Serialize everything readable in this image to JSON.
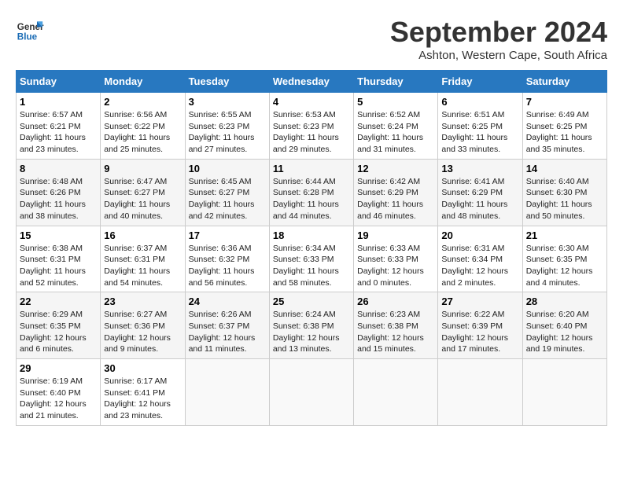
{
  "logo": {
    "line1": "General",
    "line2": "Blue"
  },
  "title": "September 2024",
  "location": "Ashton, Western Cape, South Africa",
  "headers": [
    "Sunday",
    "Monday",
    "Tuesday",
    "Wednesday",
    "Thursday",
    "Friday",
    "Saturday"
  ],
  "weeks": [
    [
      {
        "day": "1",
        "info": "Sunrise: 6:57 AM\nSunset: 6:21 PM\nDaylight: 11 hours\nand 23 minutes."
      },
      {
        "day": "2",
        "info": "Sunrise: 6:56 AM\nSunset: 6:22 PM\nDaylight: 11 hours\nand 25 minutes."
      },
      {
        "day": "3",
        "info": "Sunrise: 6:55 AM\nSunset: 6:23 PM\nDaylight: 11 hours\nand 27 minutes."
      },
      {
        "day": "4",
        "info": "Sunrise: 6:53 AM\nSunset: 6:23 PM\nDaylight: 11 hours\nand 29 minutes."
      },
      {
        "day": "5",
        "info": "Sunrise: 6:52 AM\nSunset: 6:24 PM\nDaylight: 11 hours\nand 31 minutes."
      },
      {
        "day": "6",
        "info": "Sunrise: 6:51 AM\nSunset: 6:25 PM\nDaylight: 11 hours\nand 33 minutes."
      },
      {
        "day": "7",
        "info": "Sunrise: 6:49 AM\nSunset: 6:25 PM\nDaylight: 11 hours\nand 35 minutes."
      }
    ],
    [
      {
        "day": "8",
        "info": "Sunrise: 6:48 AM\nSunset: 6:26 PM\nDaylight: 11 hours\nand 38 minutes."
      },
      {
        "day": "9",
        "info": "Sunrise: 6:47 AM\nSunset: 6:27 PM\nDaylight: 11 hours\nand 40 minutes."
      },
      {
        "day": "10",
        "info": "Sunrise: 6:45 AM\nSunset: 6:27 PM\nDaylight: 11 hours\nand 42 minutes."
      },
      {
        "day": "11",
        "info": "Sunrise: 6:44 AM\nSunset: 6:28 PM\nDaylight: 11 hours\nand 44 minutes."
      },
      {
        "day": "12",
        "info": "Sunrise: 6:42 AM\nSunset: 6:29 PM\nDaylight: 11 hours\nand 46 minutes."
      },
      {
        "day": "13",
        "info": "Sunrise: 6:41 AM\nSunset: 6:29 PM\nDaylight: 11 hours\nand 48 minutes."
      },
      {
        "day": "14",
        "info": "Sunrise: 6:40 AM\nSunset: 6:30 PM\nDaylight: 11 hours\nand 50 minutes."
      }
    ],
    [
      {
        "day": "15",
        "info": "Sunrise: 6:38 AM\nSunset: 6:31 PM\nDaylight: 11 hours\nand 52 minutes."
      },
      {
        "day": "16",
        "info": "Sunrise: 6:37 AM\nSunset: 6:31 PM\nDaylight: 11 hours\nand 54 minutes."
      },
      {
        "day": "17",
        "info": "Sunrise: 6:36 AM\nSunset: 6:32 PM\nDaylight: 11 hours\nand 56 minutes."
      },
      {
        "day": "18",
        "info": "Sunrise: 6:34 AM\nSunset: 6:33 PM\nDaylight: 11 hours\nand 58 minutes."
      },
      {
        "day": "19",
        "info": "Sunrise: 6:33 AM\nSunset: 6:33 PM\nDaylight: 12 hours\nand 0 minutes."
      },
      {
        "day": "20",
        "info": "Sunrise: 6:31 AM\nSunset: 6:34 PM\nDaylight: 12 hours\nand 2 minutes."
      },
      {
        "day": "21",
        "info": "Sunrise: 6:30 AM\nSunset: 6:35 PM\nDaylight: 12 hours\nand 4 minutes."
      }
    ],
    [
      {
        "day": "22",
        "info": "Sunrise: 6:29 AM\nSunset: 6:35 PM\nDaylight: 12 hours\nand 6 minutes."
      },
      {
        "day": "23",
        "info": "Sunrise: 6:27 AM\nSunset: 6:36 PM\nDaylight: 12 hours\nand 9 minutes."
      },
      {
        "day": "24",
        "info": "Sunrise: 6:26 AM\nSunset: 6:37 PM\nDaylight: 12 hours\nand 11 minutes."
      },
      {
        "day": "25",
        "info": "Sunrise: 6:24 AM\nSunset: 6:38 PM\nDaylight: 12 hours\nand 13 minutes."
      },
      {
        "day": "26",
        "info": "Sunrise: 6:23 AM\nSunset: 6:38 PM\nDaylight: 12 hours\nand 15 minutes."
      },
      {
        "day": "27",
        "info": "Sunrise: 6:22 AM\nSunset: 6:39 PM\nDaylight: 12 hours\nand 17 minutes."
      },
      {
        "day": "28",
        "info": "Sunrise: 6:20 AM\nSunset: 6:40 PM\nDaylight: 12 hours\nand 19 minutes."
      }
    ],
    [
      {
        "day": "29",
        "info": "Sunrise: 6:19 AM\nSunset: 6:40 PM\nDaylight: 12 hours\nand 21 minutes."
      },
      {
        "day": "30",
        "info": "Sunrise: 6:17 AM\nSunset: 6:41 PM\nDaylight: 12 hours\nand 23 minutes."
      },
      {
        "day": "",
        "info": ""
      },
      {
        "day": "",
        "info": ""
      },
      {
        "day": "",
        "info": ""
      },
      {
        "day": "",
        "info": ""
      },
      {
        "day": "",
        "info": ""
      }
    ]
  ]
}
